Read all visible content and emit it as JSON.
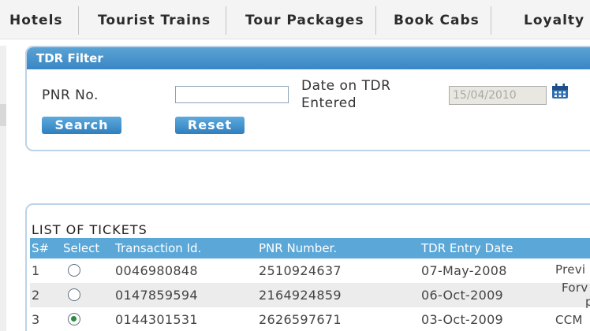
{
  "nav": {
    "items": [
      {
        "label": "Hotels"
      },
      {
        "label": "Tourist Trains"
      },
      {
        "label": "Tour Packages"
      },
      {
        "label": "Book Cabs"
      },
      {
        "label": "Loyalty P"
      }
    ]
  },
  "filter": {
    "title": "TDR Filter",
    "pnr_label": "PNR No.",
    "pnr_value": "",
    "date_label_line1": "Date on TDR",
    "date_label_line2": "Entered",
    "date_value": "15/04/2010",
    "search_label": "Search",
    "reset_label": "Reset",
    "calendar_icon": "calendar-icon"
  },
  "tickets": {
    "title": "LIST OF TICKETS",
    "columns": {
      "sno": "S#",
      "select": "Select",
      "transaction": "Transaction Id.",
      "pnr": "PNR Number.",
      "tdr_date": "TDR Entry Date"
    },
    "rows": [
      {
        "sno": "1",
        "selected": false,
        "transaction": "0046980848",
        "pnr": "2510924637",
        "tdr_date": "07-May-2008",
        "remark_line1": "Previ",
        "remark_line2": ""
      },
      {
        "sno": "2",
        "selected": false,
        "transaction": "0147859594",
        "pnr": "2164924859",
        "tdr_date": "06-Oct-2009",
        "remark_line1": "Forv",
        "remark_line2": "p"
      },
      {
        "sno": "3",
        "selected": true,
        "transaction": "0144301531",
        "pnr": "2626597671",
        "tdr_date": "03-Oct-2009",
        "remark_line1": "CCM",
        "remark_line2": ""
      }
    ]
  },
  "colors": {
    "panel_header": "#3a86c4",
    "table_header": "#5aa7d8",
    "button": "#2f7fc0",
    "selected_radio": "#2e8b3e"
  }
}
